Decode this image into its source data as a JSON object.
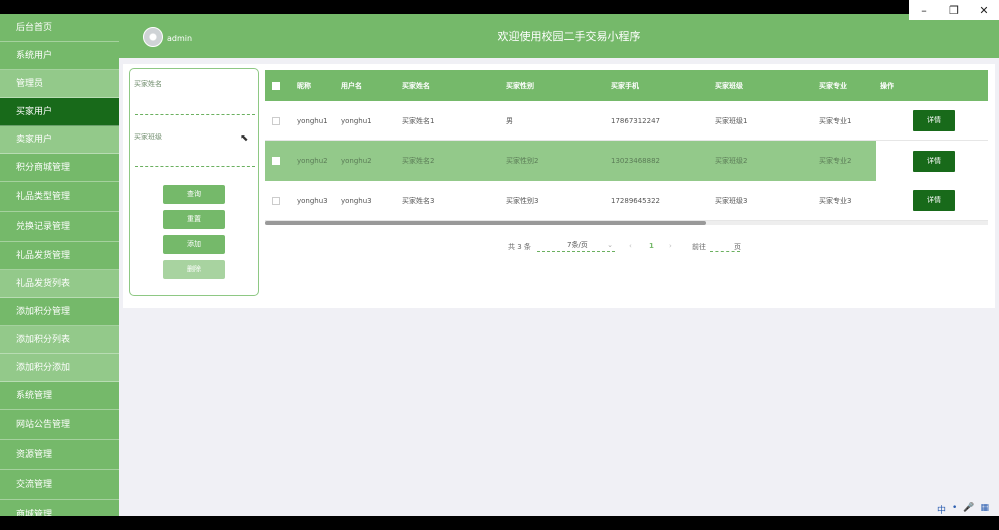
{
  "window_controls": {
    "minimize": "–",
    "maximize": "❐",
    "close": "✕"
  },
  "sidebar": {
    "items": [
      {
        "label": "后台首页",
        "style": "normal"
      },
      {
        "label": "系统用户",
        "style": "normal"
      },
      {
        "label": "管理员",
        "style": "sub"
      },
      {
        "label": "买家用户",
        "style": "active"
      },
      {
        "label": "卖家用户",
        "style": "sub"
      },
      {
        "label": "积分商城管理",
        "style": "normal"
      },
      {
        "label": "礼品类型管理",
        "style": "normal"
      },
      {
        "label": "兑换记录管理",
        "style": "normal"
      },
      {
        "label": "礼品发货管理",
        "style": "normal"
      },
      {
        "label": "礼品发货列表",
        "style": "sub"
      },
      {
        "label": "添加积分管理",
        "style": "normal"
      },
      {
        "label": "添加积分列表",
        "style": "sub"
      },
      {
        "label": "添加积分添加",
        "style": "sub"
      },
      {
        "label": "系统管理",
        "style": "normal"
      },
      {
        "label": "网站公告管理",
        "style": "normal"
      },
      {
        "label": "资源管理",
        "style": "normal"
      },
      {
        "label": "交流管理",
        "style": "normal"
      },
      {
        "label": "商城管理",
        "style": "normal"
      }
    ]
  },
  "header": {
    "username": "admin",
    "title": "欢迎使用校园二手交易小程序"
  },
  "search": {
    "field1_label": "买家姓名",
    "field2_label": "买家班级",
    "query_button": "查询",
    "reset_button": "重置",
    "add_button": "添加",
    "delete_button": "删除"
  },
  "table": {
    "headers": [
      "昵称",
      "用户名",
      "买家姓名",
      "买家性别",
      "买家手机",
      "买家班级",
      "买家专业",
      "操作"
    ],
    "rows": [
      {
        "nickname": "yonghu1",
        "username": "yonghu1",
        "name": "买家姓名1",
        "gender": "男",
        "phone": "17867312247",
        "class": "买家班级1",
        "major": "买家专业1",
        "action": "详情"
      },
      {
        "nickname": "yonghu2",
        "username": "yonghu2",
        "name": "买家姓名2",
        "gender": "买家性别2",
        "phone": "13023468882",
        "class": "买家班级2",
        "major": "买家专业2",
        "action": "详情"
      },
      {
        "nickname": "yonghu3",
        "username": "yonghu3",
        "name": "买家姓名3",
        "gender": "买家性别3",
        "phone": "17289645322",
        "class": "买家班级3",
        "major": "买家专业3",
        "action": "详情"
      }
    ]
  },
  "pager": {
    "total": "共 3 条",
    "page_size": "7条/页",
    "prev": "‹",
    "current_page": "1",
    "next": "›",
    "goto_label": "前往",
    "page_unit": "页"
  },
  "tray": [
    "中",
    "•",
    "🎤",
    "▦"
  ],
  "colors": {
    "primary": "#75b96a",
    "dark": "#186a1a",
    "light": "#93c98a",
    "background": "#f0f0f5"
  }
}
